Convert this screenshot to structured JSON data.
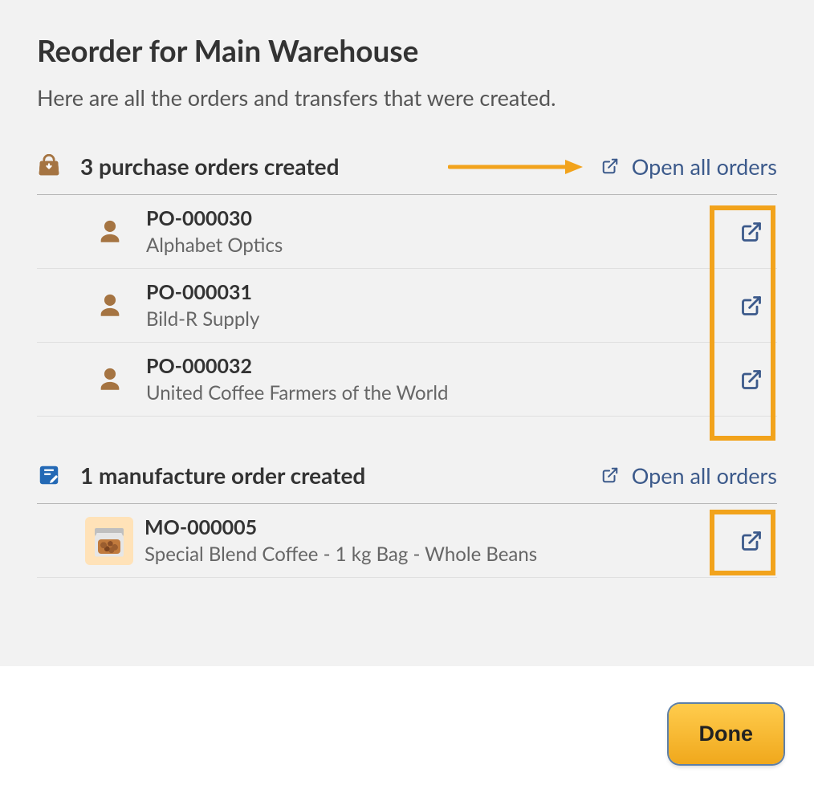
{
  "header": {
    "title": "Reorder for Main Warehouse",
    "subtitle": "Here are all the orders and transfers that were created."
  },
  "sections": {
    "purchase": {
      "title": "3 purchase orders created",
      "open_all_label": "Open all orders"
    },
    "manufacture": {
      "title": "1 manufacture order created",
      "open_all_label": "Open all orders"
    }
  },
  "purchase_orders": [
    {
      "id": "PO-000030",
      "party": "Alphabet Optics"
    },
    {
      "id": "PO-000031",
      "party": "Bild-R Supply"
    },
    {
      "id": "PO-000032",
      "party": "United Coffee Farmers of the World"
    }
  ],
  "manufacture_orders": [
    {
      "id": "MO-000005",
      "product": "Special Blend Coffee - 1 kg Bag - Whole Beans"
    }
  ],
  "footer": {
    "done_label": "Done"
  },
  "colors": {
    "link": "#3c5a8b",
    "accent": "#f2a31c",
    "icon_brown": "#a57442",
    "icon_blue": "#2469b5"
  }
}
